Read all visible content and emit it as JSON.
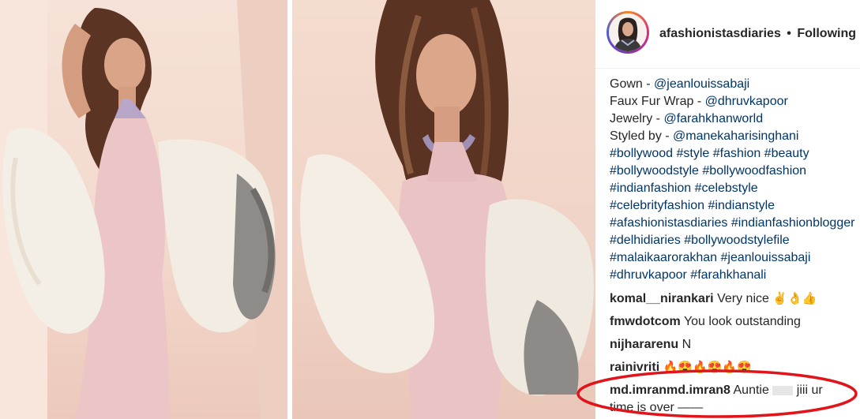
{
  "post": {
    "username": "afashionistasdiaries",
    "separator": "•",
    "follow_status": "Following"
  },
  "caption": {
    "lines": [
      {
        "label": "Gown - ",
        "link": "@jeanlouissabaji"
      },
      {
        "label": "Faux Fur Wrap - ",
        "link": "@dhruvkapoor"
      },
      {
        "label": "Jewelry - ",
        "link": "@farahkhanworld"
      },
      {
        "label": "Styled by - ",
        "link": "@manekaharisinghani"
      }
    ],
    "hashtag_lines": [
      "#bollywood #style #fashion #beauty",
      "#bollywoodstyle #bollywoodfashion",
      "#indianfashion #celebstyle",
      "#celebrityfashion #indianstyle",
      "#afashionistasdiaries #indianfashionblogger",
      "#delhidiaries #bollywoodstylefile",
      "#malaikaarorakhan #jeanlouissabaji",
      "#dhruvkapoor #farahkhanali"
    ]
  },
  "comments": [
    {
      "user": "komal__nirankari",
      "text": "Very nice",
      "emoji": "✌👌👍"
    },
    {
      "user": "fmwdotcom",
      "text": "You look outstanding",
      "emoji": ""
    },
    {
      "user": "nijhararenu",
      "text": "N",
      "emoji": ""
    },
    {
      "user": "rainivriti",
      "text": "",
      "emoji": "🔥😍🔥😍🔥😍"
    },
    {
      "user": "md.imranmd.imran8",
      "text": "Auntie",
      "text_cont": "jiii ur",
      "text_line2": "time is over ——"
    }
  ],
  "colors": {
    "link": "#003569",
    "text": "#262626",
    "highlight": "#e0151c"
  }
}
